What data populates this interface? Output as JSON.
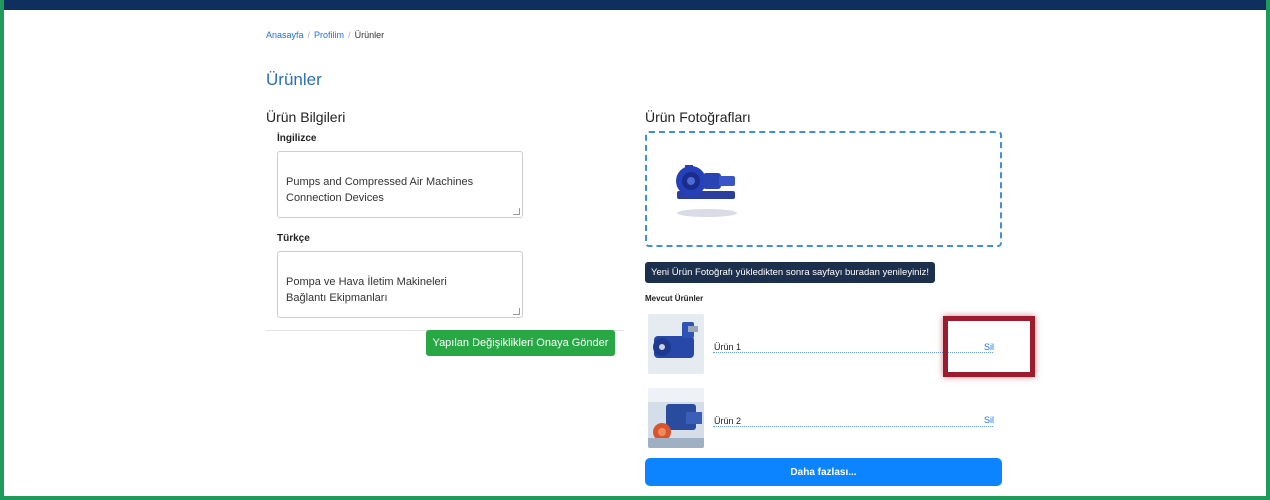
{
  "breadcrumb": {
    "items": [
      "Anasayfa",
      "Profilim",
      "Ürünler"
    ],
    "separator": "/"
  },
  "page": {
    "title": "Ürünler"
  },
  "product_info": {
    "title": "Ürün Bilgileri",
    "english": {
      "label": "İngilizce",
      "value": "Pumps and Compressed Air Machines\nConnection Devices"
    },
    "turkish": {
      "label": "Türkçe",
      "value": "Pompa ve Hava İletim Makineleri\nBağlantı Ekipmanları"
    },
    "submit_label": "Yapılan Değişiklikleri Onaya Gönder"
  },
  "photos": {
    "title": "Ürün Fotoğrafları",
    "refresh_notice": "Yeni Ürün Fotoğrafı yükledikten sonra sayfayı buradan yenileyiniz!",
    "existing_heading": "Mevcut Ürünler",
    "items": [
      {
        "name": "Ürün 1",
        "delete_label": "Sil"
      },
      {
        "name": "Ürün 2",
        "delete_label": "Sil"
      }
    ],
    "more_label": "Daha fazlası..."
  },
  "colors": {
    "frame_border": "#1f9a5b",
    "topbar": "#0f2f5e",
    "link": "#1a73e8",
    "submit": "#28a745",
    "notice": "#1c2f4d",
    "primary": "#0d84ff",
    "highlight": "#9e1b2e"
  }
}
